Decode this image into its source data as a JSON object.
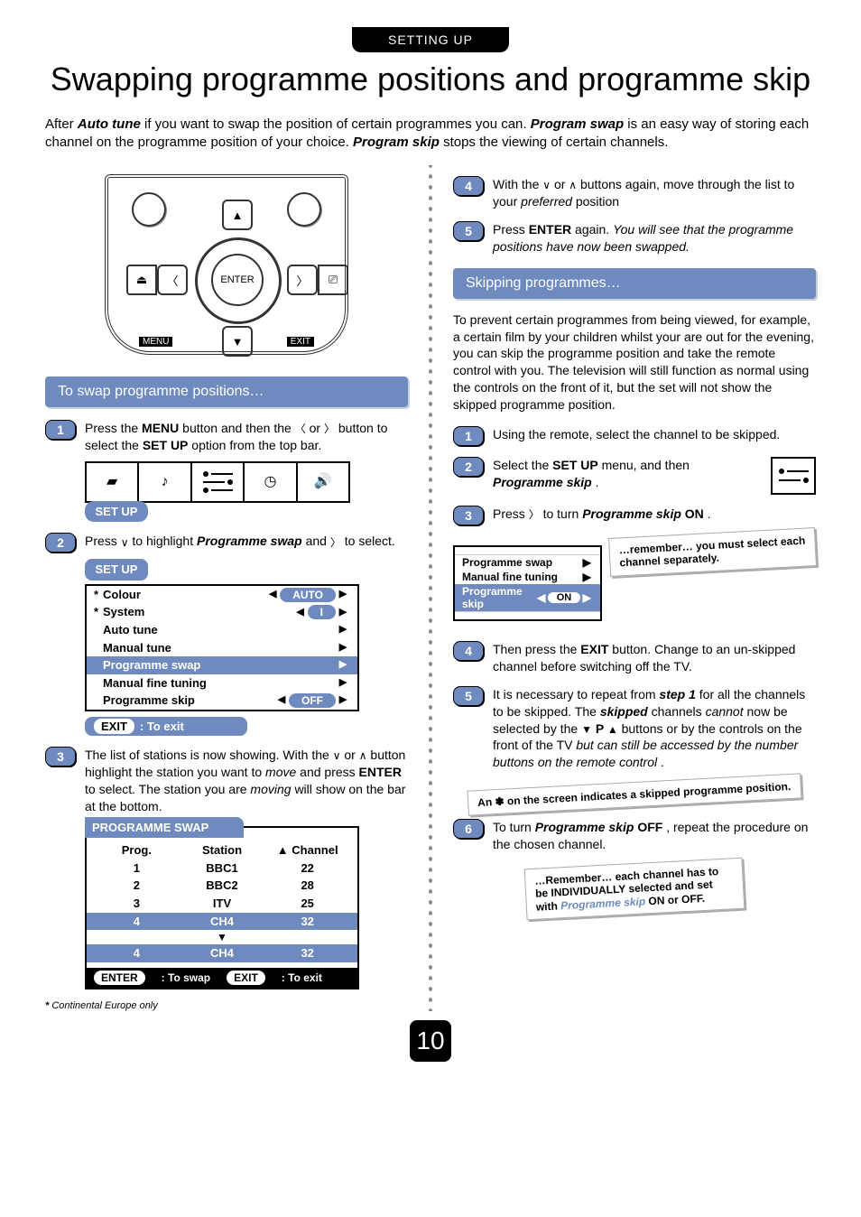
{
  "header_chip": "SETTING UP",
  "title": "Swapping programme positions and programme skip",
  "intro": {
    "seg1": "After ",
    "auto_tune": "Auto tune",
    "seg2": " if you want to swap the position of certain programmes you can. ",
    "prog_swap": "Program swap",
    "seg3": " is an easy way of storing each channel on the programme position of your choice. ",
    "prog_skip": "Program skip",
    "seg4": " stops the viewing of certain channels."
  },
  "remote": {
    "enter": "ENTER",
    "menu": "MENU",
    "exit": "EXIT"
  },
  "left": {
    "subheader": "To swap programme positions…",
    "step1": {
      "seg1": "Press the ",
      "menu": "MENU",
      "seg2": " button and then the ",
      "or": " or ",
      "seg3": " button to select the ",
      "setup": "SET UP",
      "seg4": " option from the top bar."
    },
    "osd_setup_chip": "SET UP",
    "step2": {
      "seg1": "Press ",
      "seg2": " to highlight ",
      "prog_swap": "Programme swap",
      "seg3": " and ",
      "seg4": " to select."
    },
    "setup_menu": {
      "title": "SET UP",
      "rows": [
        {
          "star": "*",
          "label": "Colour",
          "value": "AUTO",
          "l": "◀",
          "r": "▶"
        },
        {
          "star": "*",
          "label": "System",
          "value": "I",
          "l": "◀",
          "r": "▶"
        },
        {
          "star": "",
          "label": "Auto tune",
          "value": "",
          "l": "",
          "r": "▶"
        },
        {
          "star": "",
          "label": "Manual tune",
          "value": "",
          "l": "",
          "r": "▶"
        },
        {
          "star": "",
          "label": "Programme swap",
          "value": "",
          "l": "",
          "r": "▶",
          "hl": true
        },
        {
          "star": "",
          "label": "Manual fine tuning",
          "value": "",
          "l": "",
          "r": "▶"
        },
        {
          "star": "",
          "label": "Programme skip",
          "value": "OFF",
          "l": "◀",
          "r": "▶"
        }
      ],
      "footer_exit": "EXIT",
      "footer_text": ": To exit"
    },
    "step3": {
      "seg1": "The list of stations is now showing. With the ",
      "or": " or ",
      "seg2": " button highlight the station you want to ",
      "move": "move",
      "seg3": " and press ",
      "enter": "ENTER",
      "seg4": " to select. The station you are ",
      "moving": "moving",
      "seg5": " will show on the bar at the bottom."
    },
    "swap_table": {
      "title": "PROGRAMME SWAP",
      "head_prog": "Prog.",
      "head_station": "Station",
      "head_channel": "Channel",
      "head_up": "▲",
      "rows": [
        {
          "p": "1",
          "s": "BBC1",
          "c": "22"
        },
        {
          "p": "2",
          "s": "BBC2",
          "c": "28"
        },
        {
          "p": "3",
          "s": "ITV",
          "c": "25"
        },
        {
          "p": "4",
          "s": "CH4",
          "c": "32",
          "hl": true
        }
      ],
      "down": "▼",
      "bar": {
        "p": "4",
        "s": "CH4",
        "c": "32"
      },
      "footer_enter": "ENTER",
      "footer_swap": ": To swap",
      "footer_exit": "EXIT",
      "footer_exit_text": ": To exit"
    }
  },
  "right": {
    "step4": {
      "seg1": "With the ",
      "or": " or ",
      "seg2": " buttons again, move through the list to your ",
      "preferred": "preferred",
      "seg3": " position"
    },
    "step5": {
      "seg1": "Press ",
      "enter": "ENTER",
      "seg2": " again. ",
      "ital": "You will see that the programme positions have now been swapped."
    },
    "subheader": "Skipping programmes…",
    "skip_intro": "To prevent certain programmes from being viewed, for example, a certain film by your children whilst your are out for the evening, you can skip the programme position and take the remote control with you. The television will still function as normal using the controls on the front of it, but the set will not show the skipped programme position.",
    "s1": "Using the remote, select the channel to be skipped.",
    "s2": {
      "seg1": "Select the ",
      "setup": "SET UP",
      "seg2": " menu, and then ",
      "pskip": "Programme skip",
      "seg3": "."
    },
    "s3": {
      "seg1": "Press ",
      "seg2": " to turn ",
      "pskip": "Programme skip",
      "on": " ON",
      "seg3": "."
    },
    "mini_menu": {
      "rows": [
        {
          "label": "Programme swap",
          "r": "▶"
        },
        {
          "label": "Manual fine tuning",
          "r": "▶"
        },
        {
          "label": "Programme skip",
          "l": "◀",
          "value": "ON",
          "r": "▶",
          "hl": true
        }
      ]
    },
    "callout1": "…remember… you must select each channel separately.",
    "s4": {
      "seg1": "Then press the ",
      "exit": "EXIT",
      "seg2": " button. Change to an un-skipped channel before switching off the TV."
    },
    "s5": {
      "seg1": "It is necessary to repeat from ",
      "step1": "step 1",
      "seg2": " for all the channels to be skipped. The ",
      "skipped": "skipped",
      "seg3": " channels ",
      "cannot": "cannot",
      "seg4": " now be selected by the ",
      "p": " P ",
      "seg5": " buttons or by the controls on the front of the TV ",
      "seg6": "but can still be accessed by the number buttons on the remote control",
      "seg7": "."
    },
    "callout2_a": "An ",
    "callout2_ast": "✽",
    "callout2_b": " on the screen indicates a skipped programme position.",
    "s6": {
      "seg1": "To turn ",
      "pskip": "Programme skip",
      "off": " OFF",
      "seg2": ", repeat the procedure on the chosen channel."
    },
    "callout3_a": "…Remember… each channel has to be ",
    "callout3_b": "INDIVIDUALLY",
    "callout3_c": " selected and set with ",
    "callout3_d": "Programme skip",
    "callout3_e": " ON ",
    "callout3_f": "or",
    "callout3_g": " OFF."
  },
  "footnote_ast": "*",
  "footnote": " Continental Europe only",
  "page_number": "10"
}
